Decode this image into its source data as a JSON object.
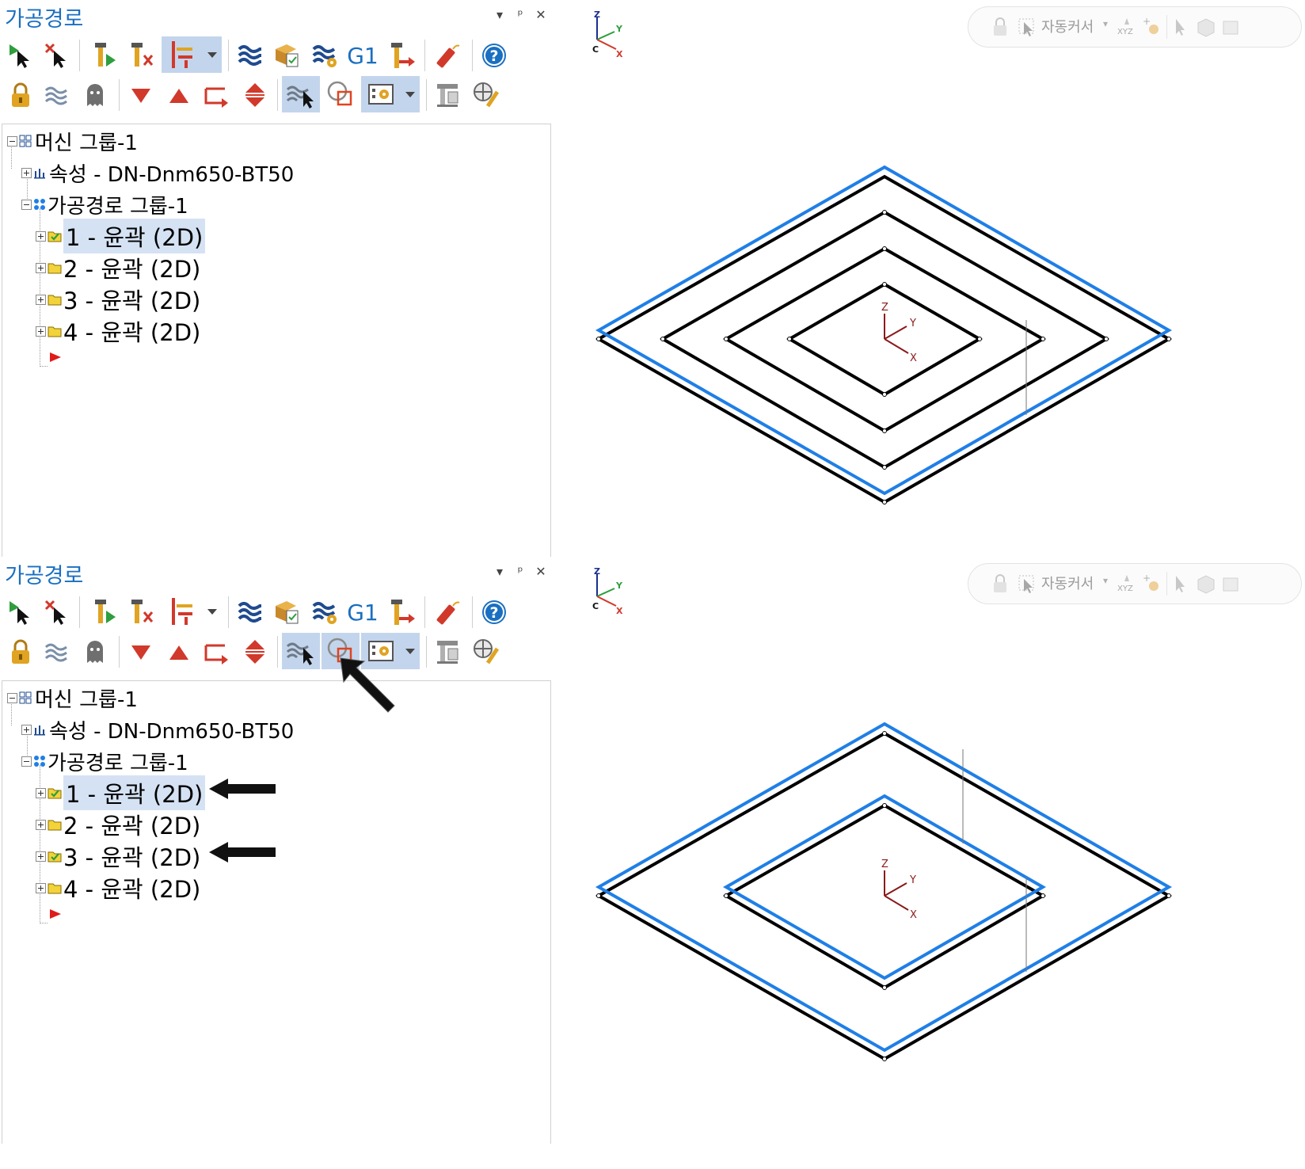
{
  "panels": [
    {
      "title": "가공경로",
      "tree": {
        "root": "머신 그룹-1",
        "properties": "속성 - DN-Dnm650-BT50",
        "group": "가공경로 그룹-1",
        "operations": [
          "1 - 윤곽 (2D)",
          "2 - 윤곽 (2D)",
          "3 - 윤곽 (2D)",
          "4 - 윤곽 (2D)"
        ]
      },
      "viewport": {
        "autocursor_label": "자동커서",
        "triad": {
          "z": "Z",
          "y": "Y",
          "x": "X",
          "c": "C"
        }
      }
    },
    {
      "title": "가공경로",
      "tree": {
        "root": "머신 그룹-1",
        "properties": "속성 - DN-Dnm650-BT50",
        "group": "가공경로 그룹-1",
        "operations": [
          "1 - 윤곽 (2D)",
          "2 - 윤곽 (2D)",
          "3 - 윤곽 (2D)",
          "4 - 윤곽 (2D)"
        ]
      },
      "viewport": {
        "autocursor_label": "자동커서",
        "triad": {
          "z": "Z",
          "y": "Y",
          "x": "X",
          "c": "C"
        }
      }
    }
  ],
  "toolbar": {
    "g1_label": "G1"
  },
  "colors": {
    "title_blue": "#1a6fc1",
    "path_blue": "#1f7fe6",
    "path_black": "#000000",
    "selected_bg": "#d5e2f3",
    "active_btn": "#c3d5ec"
  }
}
